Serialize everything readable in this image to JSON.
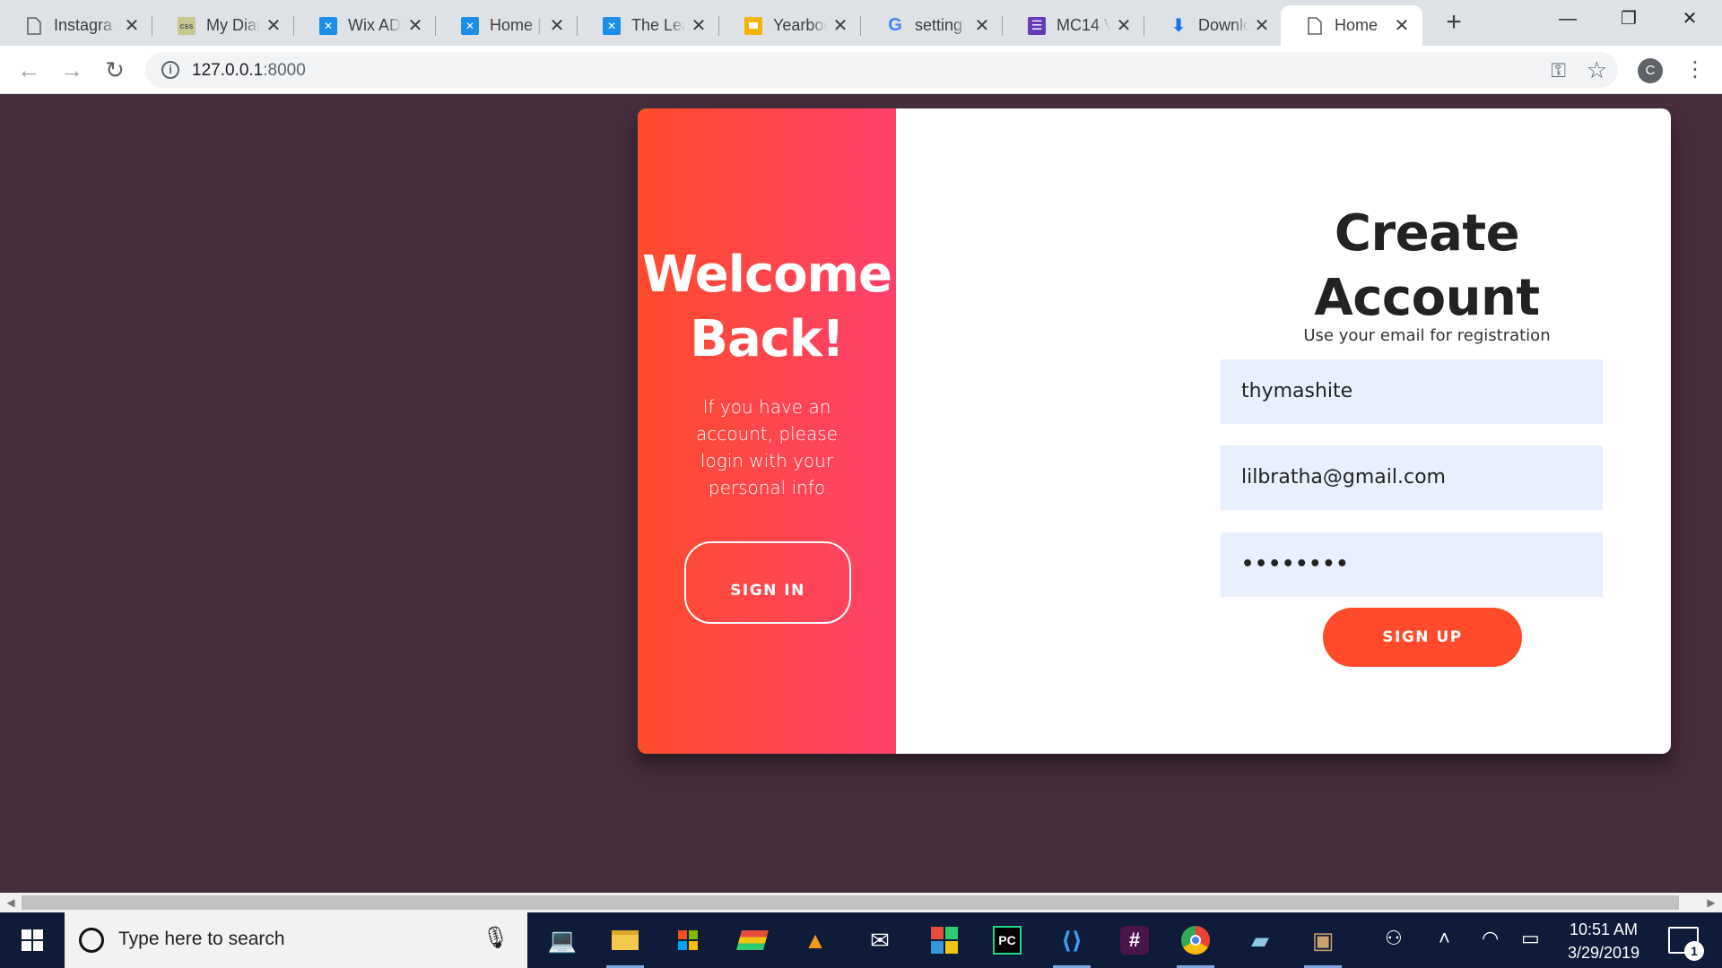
{
  "browser": {
    "tabs": [
      {
        "title": "Instagra",
        "icon": "page-icon",
        "color": "#5f6368"
      },
      {
        "title": "My Diar",
        "icon": "css-icon",
        "color": "#b8b87a"
      },
      {
        "title": "Wix ADI",
        "icon": "wix-icon",
        "color": "#1d8ee8"
      },
      {
        "title": "Home |",
        "icon": "wix-icon",
        "color": "#1d8ee8"
      },
      {
        "title": "The Lea",
        "icon": "wix-icon",
        "color": "#1d8ee8"
      },
      {
        "title": "Yearboo",
        "icon": "slides-icon",
        "color": "#f4b400"
      },
      {
        "title": "setting",
        "icon": "google-icon",
        "color": "#4285f4"
      },
      {
        "title": "MC14 V",
        "icon": "forms-icon",
        "color": "#673ab7"
      },
      {
        "title": "Downlo",
        "icon": "download-icon",
        "color": "#1a73e8"
      },
      {
        "title": "Home",
        "icon": "page-icon",
        "color": "#5f6368",
        "active": true
      }
    ],
    "close_glyph": "✕",
    "new_tab_glyph": "+",
    "window_controls": {
      "minimize": "—",
      "maximize": "❐",
      "close": "✕"
    },
    "url_host": "127.0.0.1",
    "url_port": ":8000",
    "profile_initial": "C"
  },
  "page": {
    "overlay": {
      "title": "Welcome Back!",
      "text": "If you have an account, please login with your personal info",
      "button_label": "SIGN IN",
      "gradient": [
        "#ff4b2b",
        "#ff416c"
      ]
    },
    "form": {
      "title": "Create Account",
      "subtitle": "Use your email for registration",
      "name_value": "thymashite",
      "email_value": "lilbratha@gmail.com",
      "password_value": "••••••••",
      "button_label": "SIGN UP",
      "button_color": "#ff4b2b"
    }
  },
  "taskbar": {
    "search_placeholder": "Type here to search",
    "time": "10:51 AM",
    "date": "3/29/2019",
    "notification_count": "1",
    "apps": [
      "laptop-icon",
      "file-explorer-icon",
      "store-icon",
      "stacks-icon",
      "vlc-icon",
      "mail-icon",
      "office-icon",
      "pycharm-icon",
      "vscode-icon",
      "slack-icon",
      "chrome-icon",
      "notepad-icon",
      "archive-icon"
    ]
  }
}
